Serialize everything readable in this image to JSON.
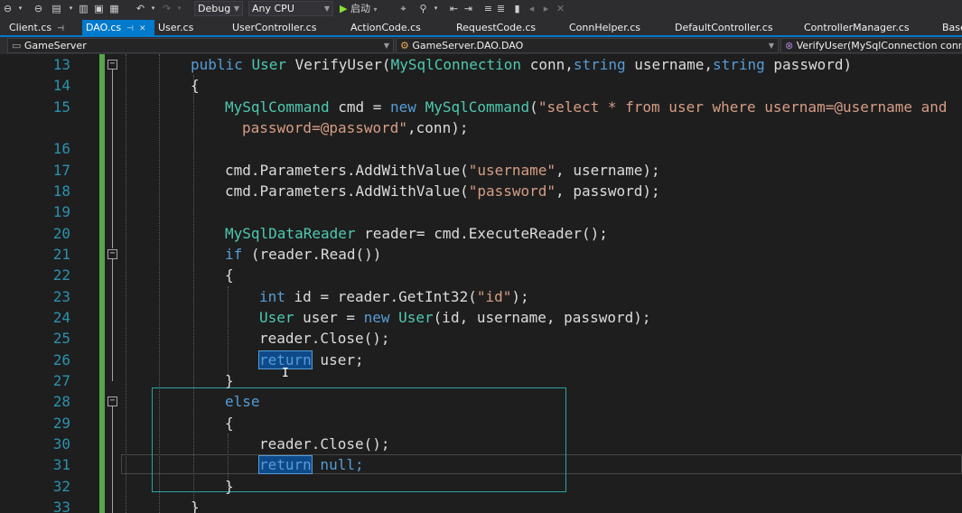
{
  "toolbar": {
    "config": "Debug",
    "platform": "Any CPU",
    "start_label": "启动"
  },
  "tabs": [
    {
      "label": "Client.cs"
    },
    {
      "label": "DAO.cs"
    },
    {
      "label": "User.cs"
    },
    {
      "label": "UserController.cs"
    },
    {
      "label": "ActionCode.cs"
    },
    {
      "label": "RequestCode.cs"
    },
    {
      "label": "ConnHelper.cs"
    },
    {
      "label": "DefaultController.cs"
    },
    {
      "label": "ControllerManager.cs"
    },
    {
      "label": "Base"
    }
  ],
  "navbar": {
    "project": "GameServer",
    "type": "GameServer.DAO.DAO",
    "member": "VerifyUser(MySqlConnection conn, s"
  },
  "editor": {
    "line_numbers": [
      "13",
      "14",
      "15",
      "16",
      "17",
      "18",
      "19",
      "20",
      "21",
      "22",
      "23",
      "24",
      "25",
      "26",
      "27",
      "28",
      "29",
      "30",
      "31",
      "32",
      "33"
    ],
    "code": {
      "l13": [
        "public",
        " ",
        "User",
        " VerifyUser(",
        "MySqlConnection",
        " conn,",
        "string",
        " username,",
        "string",
        " password)"
      ],
      "l14": [
        "{"
      ],
      "l15a": [
        "MySqlCommand",
        " cmd = ",
        "new",
        " ",
        "MySqlCommand",
        "(",
        "\"select * from user where usernam=@username and"
      ],
      "l15b": [
        "password=@password\"",
        ",conn);"
      ],
      "l17": [
        "cmd.Parameters.AddWithValue(",
        "\"username\"",
        ", username);"
      ],
      "l18": [
        "cmd.Parameters.AddWithValue(",
        "\"password\"",
        ", password);"
      ],
      "l20": [
        "MySqlDataReader",
        " reader= cmd.ExecuteReader();"
      ],
      "l21": [
        "if",
        " (reader.Read())"
      ],
      "l22": [
        "{"
      ],
      "l23": [
        "int",
        " id = reader.GetInt32(",
        "\"id\"",
        ");"
      ],
      "l24": [
        "User",
        " user = ",
        "new",
        " ",
        "User",
        "(id, username, password);"
      ],
      "l25": [
        "reader.Close();"
      ],
      "l26": [
        "return",
        " user;"
      ],
      "l27": [
        "}"
      ],
      "l28": [
        "else"
      ],
      "l29": [
        "{"
      ],
      "l30": [
        "reader.Close();"
      ],
      "l31": [
        "return",
        " null;"
      ],
      "l32": [
        "}"
      ],
      "l33": [
        "}"
      ]
    }
  },
  "colors": {
    "keyword": "#569cd6",
    "type": "#4ec9b0",
    "string": "#d69d85",
    "line_number": "#2b91af",
    "active_tab": "#007acc"
  }
}
